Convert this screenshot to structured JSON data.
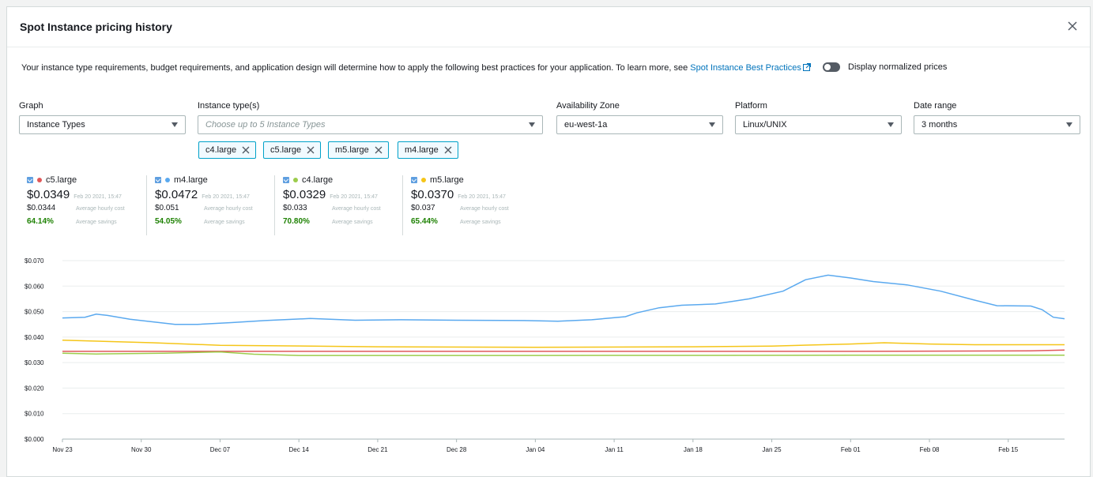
{
  "modal": {
    "title": "Spot Instance pricing history",
    "close_icon": "close-icon"
  },
  "description": {
    "text": "Your instance type requirements, budget requirements, and application design will determine how to apply the following best practices for your application. To learn more, see ",
    "link_label": "Spot Instance Best Practices"
  },
  "toggle": {
    "label": "Display normalized prices",
    "on": false
  },
  "filters": {
    "graph": {
      "label": "Graph",
      "value": "Instance Types"
    },
    "instance_types": {
      "label": "Instance type(s)",
      "placeholder": "Choose up to 5 Instance Types"
    },
    "availability_zone": {
      "label": "Availability Zone",
      "value": "eu-west-1a"
    },
    "platform": {
      "label": "Platform",
      "value": "Linux/UNIX"
    },
    "date_range": {
      "label": "Date range",
      "value": "3 months"
    }
  },
  "tokens": [
    "c4.large",
    "c5.large",
    "m5.large",
    "m4.large"
  ],
  "series_summary": [
    {
      "name": "c5.large",
      "color": "#e15759",
      "price": "$0.0349",
      "timestamp": "Feb 20 2021, 15:47",
      "avg_cost": "$0.0344",
      "avg_cost_label": "Average hourly cost",
      "savings": "64.14%",
      "savings_label": "Average savings"
    },
    {
      "name": "m4.large",
      "color": "#5aa9ef",
      "price": "$0.0472",
      "timestamp": "Feb 20 2021, 15:47",
      "avg_cost": "$0.051",
      "avg_cost_label": "Average hourly cost",
      "savings": "54.05%",
      "savings_label": "Average savings"
    },
    {
      "name": "c4.large",
      "color": "#9ccc4b",
      "price": "$0.0329",
      "timestamp": "Feb 20 2021, 15:47",
      "avg_cost": "$0.033",
      "avg_cost_label": "Average hourly cost",
      "savings": "70.80%",
      "savings_label": "Average savings"
    },
    {
      "name": "m5.large",
      "color": "#f5c518",
      "price": "$0.0370",
      "timestamp": "Feb 20 2021, 15:47",
      "avg_cost": "$0.037",
      "avg_cost_label": "Average hourly cost",
      "savings": "65.44%",
      "savings_label": "Average savings"
    }
  ],
  "chart_data": {
    "type": "line",
    "title": "",
    "xlabel": "",
    "ylabel": "",
    "ylim": [
      0,
      0.07
    ],
    "yticks": [
      "$0.000",
      "$0.010",
      "$0.020",
      "$0.030",
      "$0.040",
      "$0.050",
      "$0.060",
      "$0.070"
    ],
    "ytick_values": [
      0,
      0.01,
      0.02,
      0.03,
      0.04,
      0.05,
      0.06,
      0.07
    ],
    "xticks": [
      "Nov 23",
      "Nov 30",
      "Dec 07",
      "Dec 14",
      "Dec 21",
      "Dec 28",
      "Jan 04",
      "Jan 11",
      "Jan 18",
      "Jan 25",
      "Feb 01",
      "Feb 08",
      "Feb 15"
    ],
    "xtick_dates": [
      "2020-11-23",
      "2020-11-30",
      "2020-12-07",
      "2020-12-14",
      "2020-12-21",
      "2020-12-28",
      "2021-01-04",
      "2021-01-11",
      "2021-01-18",
      "2021-01-25",
      "2021-02-01",
      "2021-02-08",
      "2021-02-15"
    ],
    "xlim": [
      "2020-11-23",
      "2021-02-20"
    ],
    "grid": true,
    "series": [
      {
        "name": "m4.large",
        "color": "#5aa9ef",
        "points": [
          [
            "2020-11-23",
            0.0475
          ],
          [
            "2020-11-25",
            0.0478
          ],
          [
            "2020-11-26",
            0.049
          ],
          [
            "2020-11-27",
            0.0485
          ],
          [
            "2020-11-29",
            0.047
          ],
          [
            "2020-12-01",
            0.046
          ],
          [
            "2020-12-03",
            0.045
          ],
          [
            "2020-12-05",
            0.045
          ],
          [
            "2020-12-08",
            0.0457
          ],
          [
            "2020-12-11",
            0.0465
          ],
          [
            "2020-12-15",
            0.0473
          ],
          [
            "2020-12-19",
            0.0466
          ],
          [
            "2020-12-23",
            0.0468
          ],
          [
            "2020-12-28",
            0.0466
          ],
          [
            "2021-01-03",
            0.0465
          ],
          [
            "2021-01-06",
            0.0462
          ],
          [
            "2021-01-09",
            0.0468
          ],
          [
            "2021-01-12",
            0.048
          ],
          [
            "2021-01-13",
            0.0495
          ],
          [
            "2021-01-15",
            0.0515
          ],
          [
            "2021-01-17",
            0.0525
          ],
          [
            "2021-01-20",
            0.053
          ],
          [
            "2021-01-23",
            0.055
          ],
          [
            "2021-01-26",
            0.058
          ],
          [
            "2021-01-28",
            0.0625
          ],
          [
            "2021-01-30",
            0.0643
          ],
          [
            "2021-02-01",
            0.0632
          ],
          [
            "2021-02-03",
            0.0618
          ],
          [
            "2021-02-06",
            0.0605
          ],
          [
            "2021-02-09",
            0.058
          ],
          [
            "2021-02-12",
            0.0545
          ],
          [
            "2021-02-14",
            0.0523
          ],
          [
            "2021-02-17",
            0.0522
          ],
          [
            "2021-02-18",
            0.0508
          ],
          [
            "2021-02-19",
            0.0478
          ],
          [
            "2021-02-20",
            0.0472
          ]
        ]
      },
      {
        "name": "m5.large",
        "color": "#f5c518",
        "points": [
          [
            "2020-11-23",
            0.0388
          ],
          [
            "2020-12-01",
            0.0378
          ],
          [
            "2020-12-07",
            0.0368
          ],
          [
            "2020-12-21",
            0.0362
          ],
          [
            "2021-01-04",
            0.036
          ],
          [
            "2021-01-18",
            0.0362
          ],
          [
            "2021-01-25",
            0.0365
          ],
          [
            "2021-02-01",
            0.0373
          ],
          [
            "2021-02-04",
            0.0378
          ],
          [
            "2021-02-08",
            0.0373
          ],
          [
            "2021-02-12",
            0.037
          ],
          [
            "2021-02-20",
            0.037
          ]
        ]
      },
      {
        "name": "c5.large",
        "color": "#e15759",
        "points": [
          [
            "2020-11-23",
            0.0344
          ],
          [
            "2021-02-01",
            0.0344
          ],
          [
            "2021-02-17",
            0.0346
          ],
          [
            "2021-02-20",
            0.0349
          ]
        ]
      },
      {
        "name": "c4.large",
        "color": "#9ccc4b",
        "points": [
          [
            "2020-11-23",
            0.0337
          ],
          [
            "2020-11-26",
            0.0334
          ],
          [
            "2020-12-02",
            0.0337
          ],
          [
            "2020-12-07",
            0.0342
          ],
          [
            "2020-12-10",
            0.0333
          ],
          [
            "2020-12-14",
            0.0328
          ],
          [
            "2021-01-04",
            0.0328
          ],
          [
            "2021-02-01",
            0.0329
          ],
          [
            "2021-02-20",
            0.0329
          ]
        ]
      }
    ]
  }
}
